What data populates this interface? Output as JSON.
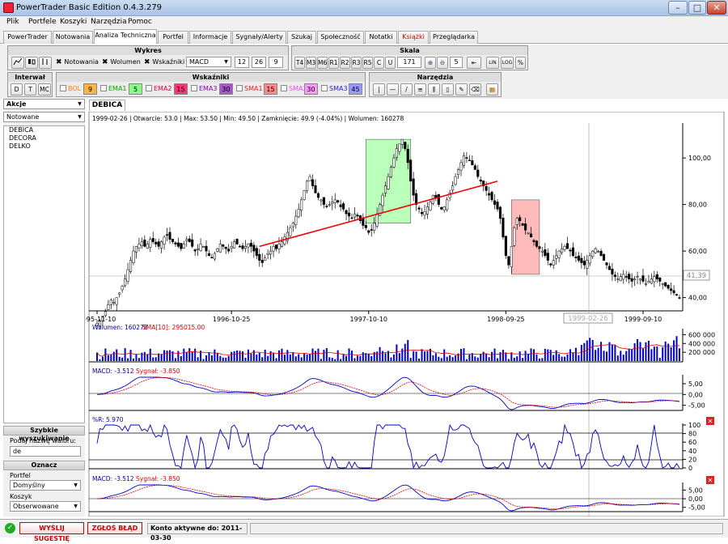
{
  "window": {
    "title": "PowerTrader Basic Edition 0.4.3.279"
  },
  "menu": [
    "Plik",
    "Portfele",
    "Koszyki",
    "Narzędzia",
    "Pomoc"
  ],
  "tabs": [
    {
      "label": "PowerTrader"
    },
    {
      "label": "Notowania"
    },
    {
      "label": "Analiza Techniczna",
      "active": true
    },
    {
      "label": "Portfel"
    },
    {
      "label": "Informacje"
    },
    {
      "label": "Sygnały/Alerty"
    },
    {
      "label": "Szukaj"
    },
    {
      "label": "Społeczność"
    },
    {
      "label": "Notatki"
    },
    {
      "label": "Książki",
      "color": "#dd0000"
    },
    {
      "label": "Przeglądarka"
    }
  ],
  "wykres": {
    "title": "Wykres",
    "notowania_label": "Notowania",
    "wolumen_label": "Wolumen",
    "wskazniki_label": "Wskaźniki",
    "indicator_select": "MACD",
    "params": [
      "12",
      "26",
      "9"
    ]
  },
  "skala": {
    "title": "Skala",
    "buttons": [
      "T4",
      "M3",
      "M6",
      "R1",
      "R2",
      "R3",
      "R5",
      "C",
      "U"
    ],
    "count": "171",
    "zoom_value": "5",
    "lin": "LIN",
    "log": "LOG",
    "pct": "%"
  },
  "interwal": {
    "title": "Interwał",
    "buttons": [
      "D",
      "T",
      "MC"
    ]
  },
  "wskazniki": {
    "title": "Wskaźniki",
    "items": [
      {
        "label": "BOL",
        "value": "9",
        "color": "#ff8800",
        "bg": "#ffb347"
      },
      {
        "label": "EMA1",
        "value": "5",
        "color": "#00aa00",
        "bg": "#88ff88"
      },
      {
        "label": "EMA2",
        "value": "15",
        "color": "#dd0044",
        "bg": "#ff3377"
      },
      {
        "label": "EMA3",
        "value": "30",
        "color": "#8800aa",
        "bg": "#aa55cc"
      },
      {
        "label": "SMA1",
        "value": "15",
        "color": "#dd2222",
        "bg": "#ff8888"
      },
      {
        "label": "SMA2",
        "value": "30",
        "color": "#ff44ff",
        "bg": "#ff99ff"
      },
      {
        "label": "SMA3",
        "value": "45",
        "color": "#2222cc",
        "bg": "#9999ff"
      }
    ]
  },
  "narzedzia": {
    "title": "Narzędzia"
  },
  "left": {
    "akcje_label": "Akcje",
    "filter": "Notowane",
    "stocks": [
      "DEBICA",
      "DECORA",
      "DELKO"
    ],
    "quick_search_title": "Szybkie wyszukiwanie",
    "quick_search_label": "Podaj nazwę waloru:",
    "quick_search_value": "de",
    "mark_title": "Oznacz",
    "portfel_label": "Portfel",
    "portfel_value": "Domyślny",
    "koszyk_label": "Koszyk",
    "koszyk_value": "Obserwowane"
  },
  "chart": {
    "tab": "DEBICA",
    "info": "1999-02-26 | Otwarcie: 53.0 | Max: 53.50 | Min: 49.50 | Zamknięcie: 49.9 (-4.04%) | Wolumen: 160278",
    "current_price_label": "41,39",
    "crosshair_date": "1999-02-26",
    "volume_label": "Wolumen: 160278",
    "volume_sma_label": "SMA[10]: 295015.00",
    "macd1_label": "MACD: -3.512",
    "macd1_signal_label": "Sygnał: -3.850",
    "wr_label": "%R: 5.970",
    "macd2_label": "MACD: -3.512",
    "macd2_signal_label": "Sygnał: -3.850"
  },
  "status": {
    "suggest_button": "WYŚLIJ SUGESTIĘ",
    "bug_button": "ZGŁOŚ BŁĄD",
    "account_text": "Konto aktywne do: 2011-03-30"
  },
  "chart_data": [
    {
      "type": "candlestick",
      "title": "DEBICA",
      "x_ticks": [
        "1995-11-10",
        "1996-10-25",
        "1997-10-10",
        "1998-09-25",
        "1999-09-10"
      ],
      "y_ticks": [
        "100,00",
        "80,00",
        "60,00",
        "40,00"
      ],
      "ylim": [
        35,
        115
      ],
      "series": [
        {
          "values": [
            29,
            30,
            32,
            34,
            37,
            39,
            38,
            40,
            42,
            45,
            48,
            52,
            56,
            60,
            62,
            63,
            64,
            62,
            63,
            65,
            64,
            63,
            62,
            64,
            66,
            67,
            65,
            64,
            63,
            62,
            61,
            63,
            65,
            64,
            62,
            60,
            61,
            63,
            62,
            60,
            58,
            57,
            59,
            61,
            63,
            62,
            61,
            60,
            62,
            64,
            63,
            62,
            61,
            62,
            63,
            62,
            60,
            58,
            56,
            55,
            57,
            59,
            60,
            62,
            61,
            63,
            64,
            66,
            68,
            70,
            72,
            75,
            78,
            82,
            86,
            90,
            92,
            88,
            85,
            83,
            82,
            80,
            79,
            80,
            81,
            82,
            81,
            79,
            78,
            76,
            75,
            74,
            76,
            75,
            73,
            71,
            70,
            68,
            69,
            72,
            76,
            80,
            84,
            88,
            92,
            96,
            100,
            104,
            106,
            108,
            104,
            98,
            90,
            84,
            80,
            78,
            76,
            77,
            79,
            81,
            84,
            83,
            80,
            78,
            79,
            82,
            85,
            88,
            92,
            95,
            98,
            101,
            100,
            99,
            97,
            95,
            92,
            90,
            88,
            86,
            84,
            82,
            80,
            78,
            74,
            66,
            58,
            54,
            62,
            70,
            74,
            73,
            71,
            69,
            68,
            66,
            64,
            62,
            61,
            60,
            58,
            56,
            54,
            56,
            58,
            60,
            61,
            62,
            61,
            60,
            58,
            57,
            56,
            55,
            54,
            56,
            58,
            60,
            61,
            60,
            58,
            56,
            54,
            52,
            50,
            49,
            48,
            49,
            50,
            49,
            48,
            47,
            48,
            49,
            48,
            47,
            46,
            47,
            48,
            49,
            48,
            47,
            46,
            45,
            44,
            43,
            42,
            41,
            40
          ]
        }
      ],
      "trendline": {
        "from": [
          "1997-01",
          62
        ],
        "to": [
          "1998-07",
          90
        ]
      },
      "highlight_boxes": [
        {
          "color": "#aaffaa",
          "ymin": 72,
          "ymax": 108
        },
        {
          "color": "#ffaaaa",
          "ymin": 50,
          "ymax": 82
        }
      ]
    },
    {
      "type": "bar",
      "title": "Wolumen",
      "y_ticks": [
        "600 000",
        "400 000",
        "200 000"
      ],
      "ylim": [
        0,
        700000
      ]
    },
    {
      "type": "line",
      "title": "MACD",
      "y_ticks": [
        "5,00",
        "0,00",
        "-5,00"
      ],
      "ylim": [
        -7,
        8
      ],
      "series": [
        {
          "name": "MACD"
        },
        {
          "name": "Sygnał"
        }
      ]
    },
    {
      "type": "line",
      "title": "%R",
      "y_ticks": [
        "100",
        "80",
        "60",
        "40",
        "20",
        "0"
      ],
      "ylim": [
        0,
        100
      ]
    },
    {
      "type": "line",
      "title": "MACD",
      "y_ticks": [
        "5,00",
        "0,00",
        "-5,00"
      ],
      "ylim": [
        -7,
        8
      ],
      "series": [
        {
          "name": "MACD"
        },
        {
          "name": "Sygnał"
        }
      ]
    }
  ]
}
